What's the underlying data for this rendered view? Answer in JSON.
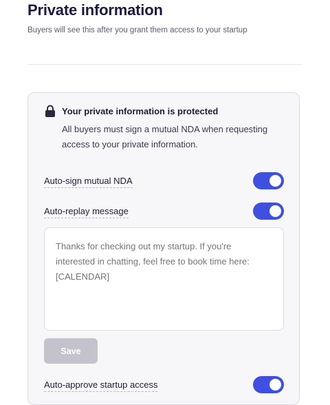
{
  "header": {
    "title": "Private information",
    "subtitle": "Buyers will see this after you grant them access to your startup"
  },
  "notice": {
    "icon": "lock-icon",
    "title": "Your private information is protected",
    "description": "All buyers must sign a mutual NDA when requesting access to your private information."
  },
  "settings": {
    "auto_sign_nda": {
      "label": "Auto-sign mutual NDA",
      "enabled": true
    },
    "auto_reply": {
      "label": "Auto-replay message",
      "enabled": true
    },
    "auto_approve": {
      "label": "Auto-approve startup access",
      "enabled": true
    }
  },
  "message": {
    "placeholder": "Thanks for checking out my startup. If you're interested in chatting, feel free to book time here: [CALENDAR]",
    "value": ""
  },
  "save_button": {
    "label": "Save"
  },
  "colors": {
    "toggle_on": "#3f4fe0",
    "save_disabled": "#c4c3cc",
    "card_bg": "#f7f7f9"
  }
}
